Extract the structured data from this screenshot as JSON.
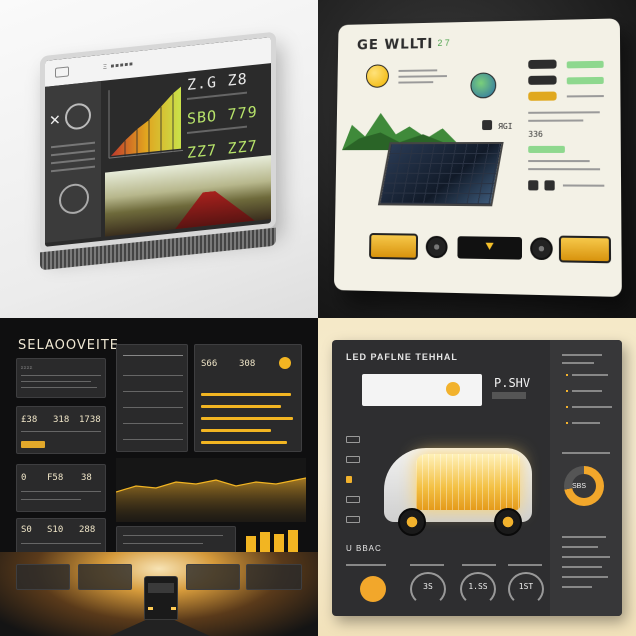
{
  "q1": {
    "menu_label": "Ξ ■■■■■",
    "stat_top_a": "Z.G",
    "stat_top_b": "Z8",
    "stat_mid_a": "SBO",
    "stat_mid_b": "779",
    "stat_bot_a": "ZZ7",
    "stat_bot_b": "ZZ7",
    "wave_glyph": "✕",
    "colors": {
      "accent": "#b7e36a",
      "screen": "#2b2b2b"
    }
  },
  "q2": {
    "title": "GE WLLTI",
    "title_num": "2 7",
    "mid_num_a": "ЯGI",
    "mid_num_b": "ЗЗ6",
    "colors": {
      "panel": "#f3f1e6",
      "battery": "#f6c84a",
      "green": "#8ed88e"
    }
  },
  "q3": {
    "title": "SELAOOVEITE",
    "card1_label": "ΣΣΣΣ",
    "num_1a": "£38",
    "num_1b": "318",
    "num_1c": "1738",
    "num_2a": "0",
    "num_2b": "F58",
    "num_2c": "38",
    "num_3a": "S0",
    "num_3b": "S10",
    "num_3c": "288",
    "num_top_a": "S66",
    "num_top_b": "308",
    "colors": {
      "accent": "#f2b522",
      "card": "#2a2a2b"
    }
  },
  "q4": {
    "title": "LED PAFLNE TEHHAL",
    "big_value": "P.SHV",
    "ring_value": "SBS",
    "bottom_title": "U BBAC",
    "dial_a": "3S",
    "dial_b": "1.SS",
    "dial_c": "1ST",
    "colors": {
      "panel": "#2e2e30",
      "accent": "#f2a72b"
    }
  }
}
